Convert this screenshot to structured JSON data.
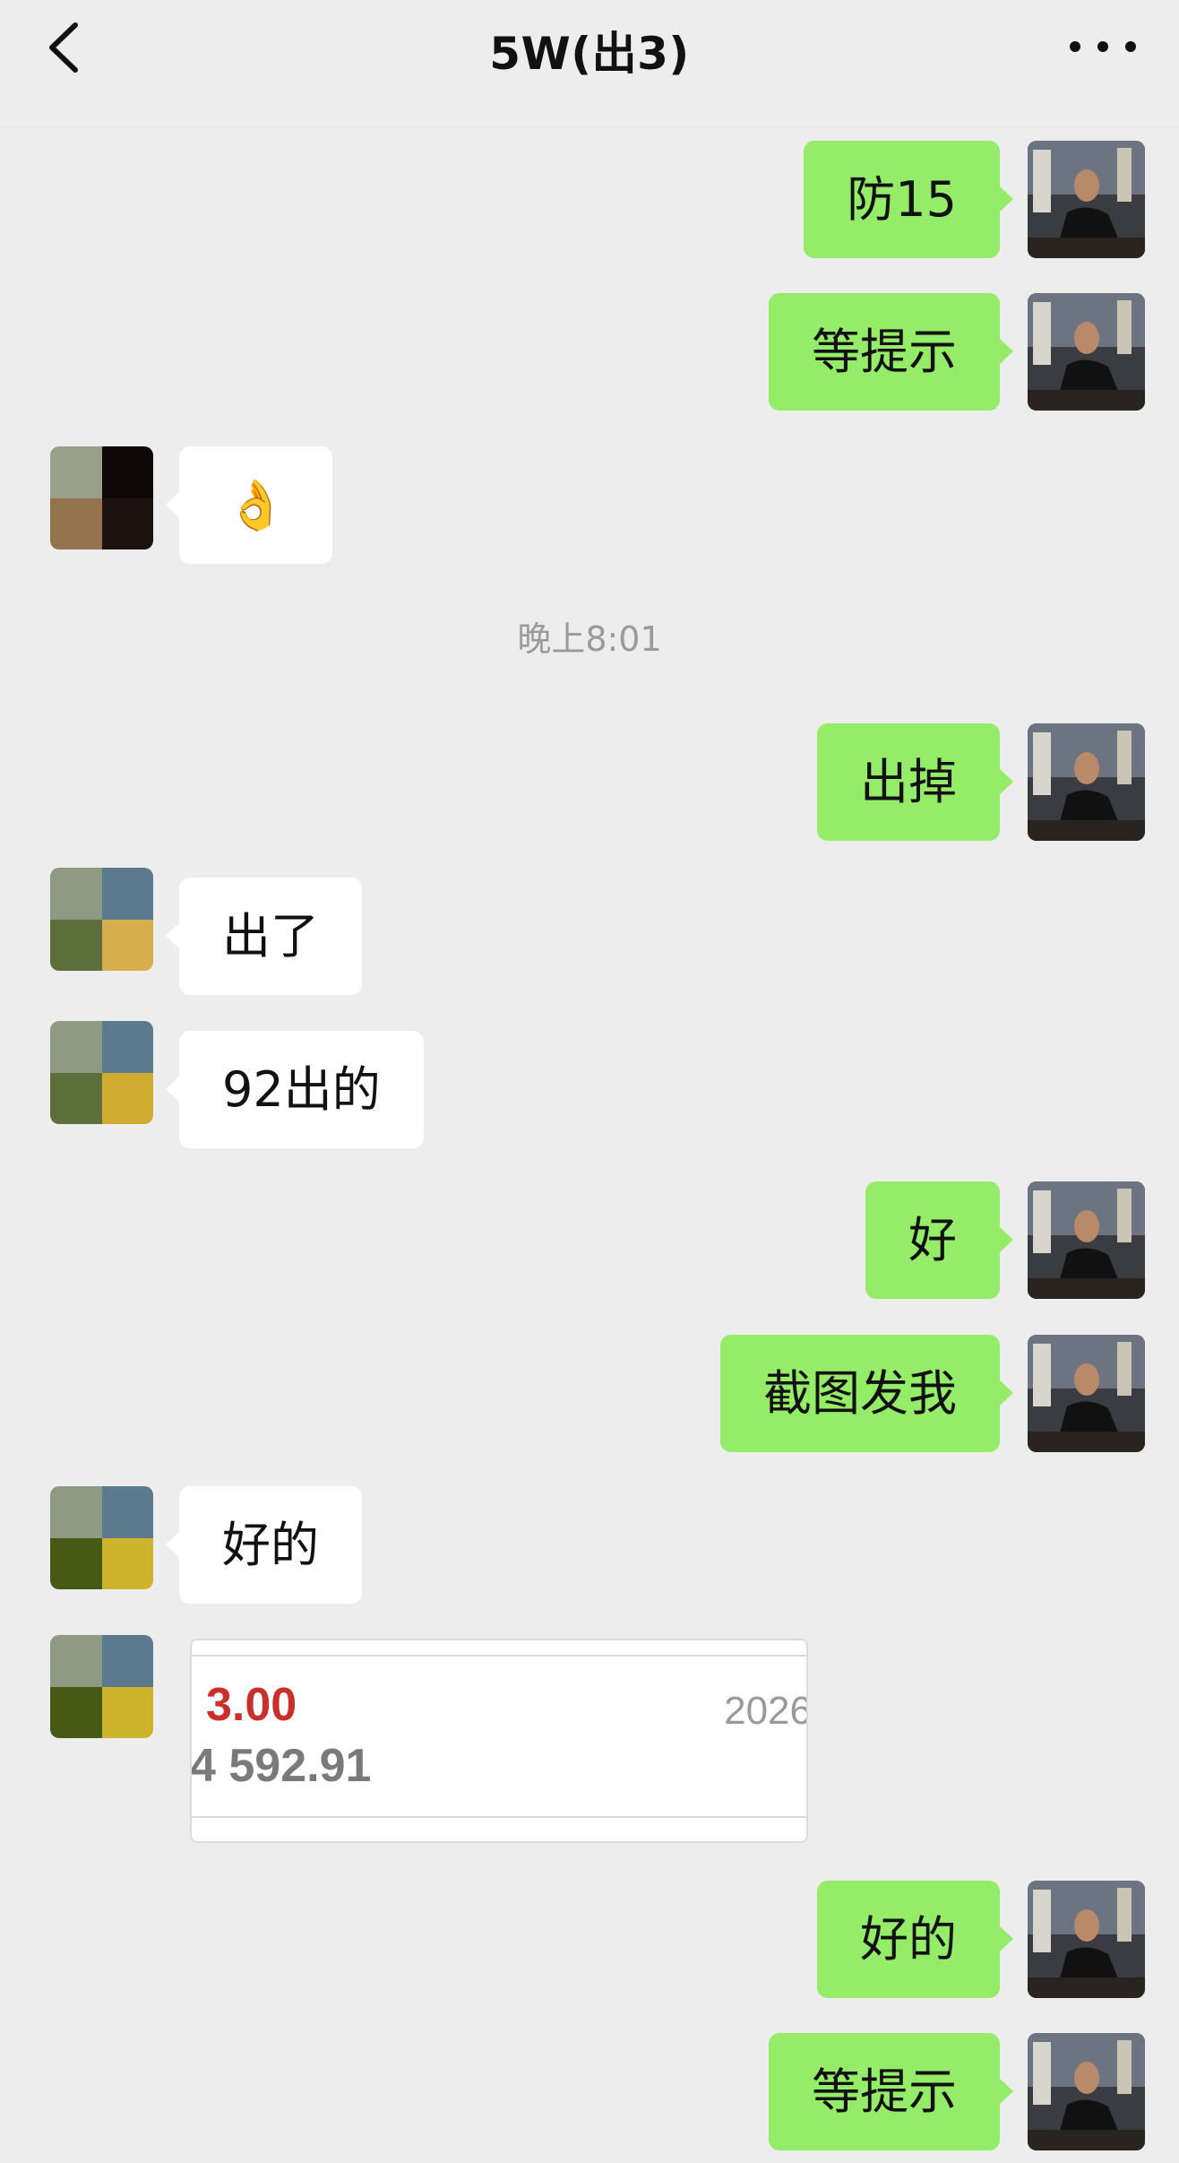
{
  "header": {
    "title": "5W(出3)",
    "back_icon": "chevron-left-icon",
    "more_icon": "more-dots-icon"
  },
  "messages": [
    {
      "from": "me",
      "text": "防15"
    },
    {
      "from": "me",
      "text": "等提示"
    },
    {
      "from": "them",
      "text": "👌"
    },
    {
      "type": "time",
      "text": "晚上8:01"
    },
    {
      "from": "me",
      "text": "出掉"
    },
    {
      "from": "them",
      "text": "出了"
    },
    {
      "from": "them",
      "text": "92出的"
    },
    {
      "from": "me",
      "text": "好"
    },
    {
      "from": "me",
      "text": "截图发我"
    },
    {
      "from": "them",
      "text": "好的"
    },
    {
      "from": "them",
      "type": "image",
      "image": {
        "value1": "3.00",
        "value2": "4 592.91",
        "value3": "2026"
      }
    },
    {
      "from": "me",
      "text": "好的"
    },
    {
      "from": "me",
      "text": "等提示"
    }
  ],
  "colors": {
    "background": "#ededed",
    "me_bubble": "#95ec69",
    "them_bubble": "#ffffff",
    "accent_red": "#c9302c"
  }
}
